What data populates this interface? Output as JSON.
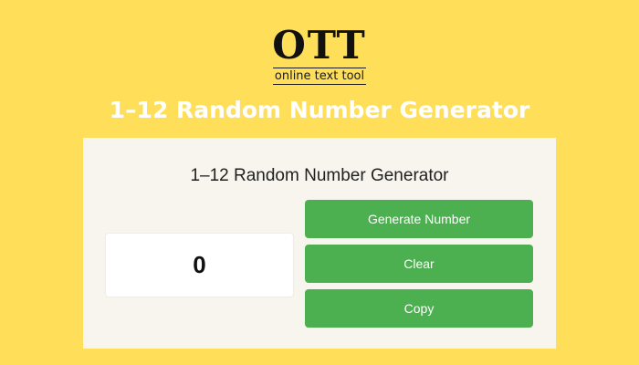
{
  "logo": {
    "mark": "OTT",
    "tagline": "online text tool"
  },
  "header": {
    "title": "1–12 Random Number Generator"
  },
  "card": {
    "title": "1–12 Random Number Generator",
    "result": "0",
    "buttons": {
      "generate_label": "Generate Number",
      "clear_label": "Clear",
      "copy_label": "Copy"
    }
  },
  "colors": {
    "background": "#FFDE59",
    "card_background": "#F8F5EF",
    "button": "#4CAF50",
    "button_text": "#FFFFFF",
    "title_text": "#FFFFFF"
  }
}
